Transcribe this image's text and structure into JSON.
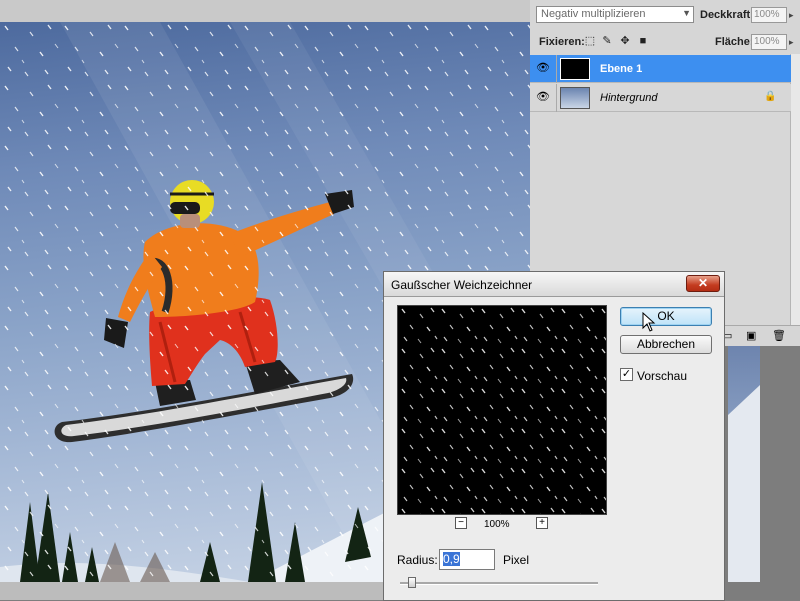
{
  "layers_panel": {
    "blend_mode": "Negativ multiplizieren",
    "opacity_label": "Deckkraft:",
    "opacity_value": "100%",
    "lock_label": "Fixieren:",
    "fill_label": "Fläche:",
    "fill_value": "100%",
    "layers": [
      {
        "name": "Ebene 1",
        "selected": true
      },
      {
        "name": "Hintergrund",
        "selected": false,
        "locked": true
      }
    ]
  },
  "dialog": {
    "title": "Gaußscher Weichzeichner",
    "close_symbol": "✕",
    "ok_label": "OK",
    "cancel_label": "Abbrechen",
    "preview_label": "Vorschau",
    "preview_checked": true,
    "zoom_minus": "−",
    "zoom_plus": "+",
    "zoom_value": "100%",
    "radius_label": "Radius:",
    "radius_value": "0,9",
    "unit_label": "Pixel",
    "slider_fraction": 0.04
  },
  "colors": {
    "selection_blue": "#3d8ff0",
    "dialog_bg": "#ececec",
    "panel_bg": "#d6d6d6"
  },
  "icons": [
    "eye-icon",
    "lock-icon",
    "close-icon",
    "checkmark-icon",
    "cursor-icon"
  ]
}
